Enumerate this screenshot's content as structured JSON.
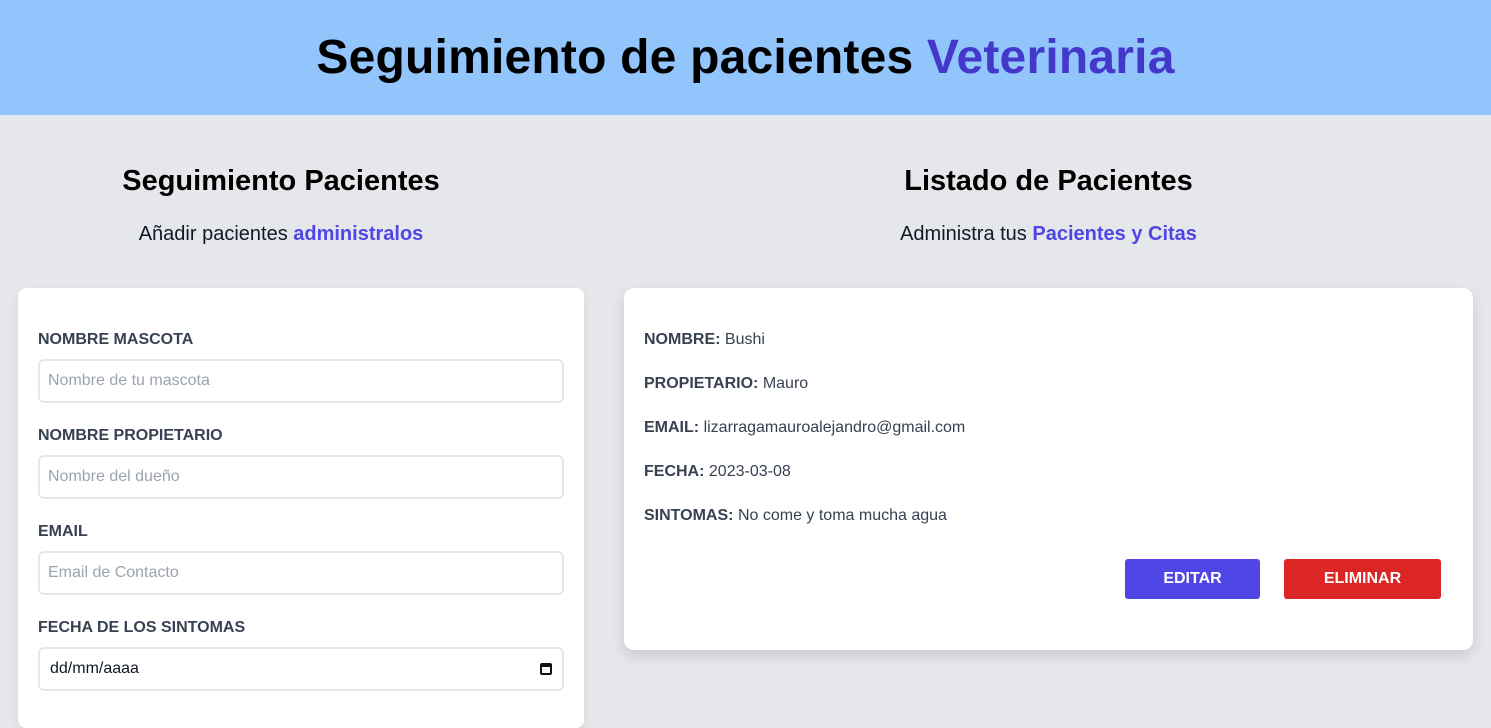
{
  "header": {
    "title_main": "Seguimiento de pacientes",
    "title_accent": "Veterinaria"
  },
  "form_section": {
    "title": "Seguimiento Pacientes",
    "subtitle_prefix": "Añadir pacientes",
    "subtitle_accent": "administralos",
    "fields": [
      {
        "label": "NOMBRE MASCOTA",
        "placeholder": "Nombre de tu mascota",
        "value": ""
      },
      {
        "label": "NOMBRE PROPIETARIO",
        "placeholder": "Nombre del dueño",
        "value": ""
      },
      {
        "label": "EMAIL",
        "placeholder": "Email de Contacto",
        "value": ""
      },
      {
        "label": "FECHA DE LOS SINTOMAS",
        "value": "dd/mm/aaaa"
      }
    ]
  },
  "list_section": {
    "title": "Listado de Pacientes",
    "subtitle_prefix": "Administra tus",
    "subtitle_accent": "Pacientes y Citas",
    "patient": {
      "name_key": "NOMBRE:",
      "name": "Bushi",
      "owner_key": "PROPIETARIO:",
      "owner": "Mauro",
      "email_key": "EMAIL:",
      "email": "lizarragamauroalejandro@gmail.com",
      "date_key": "FECHA:",
      "date": "2023-03-08",
      "symptoms_key": "SINTOMAS:",
      "symptoms": "No come y toma mucha agua"
    },
    "buttons": {
      "edit": "EDITAR",
      "delete": "ELIMINAR"
    }
  },
  "colors": {
    "header_bg": "#93c5fd",
    "accent": "#4f46e5",
    "edit_button": "#4f46e5",
    "delete_button": "#dc2626",
    "page_bg": "#e5e7eb"
  }
}
